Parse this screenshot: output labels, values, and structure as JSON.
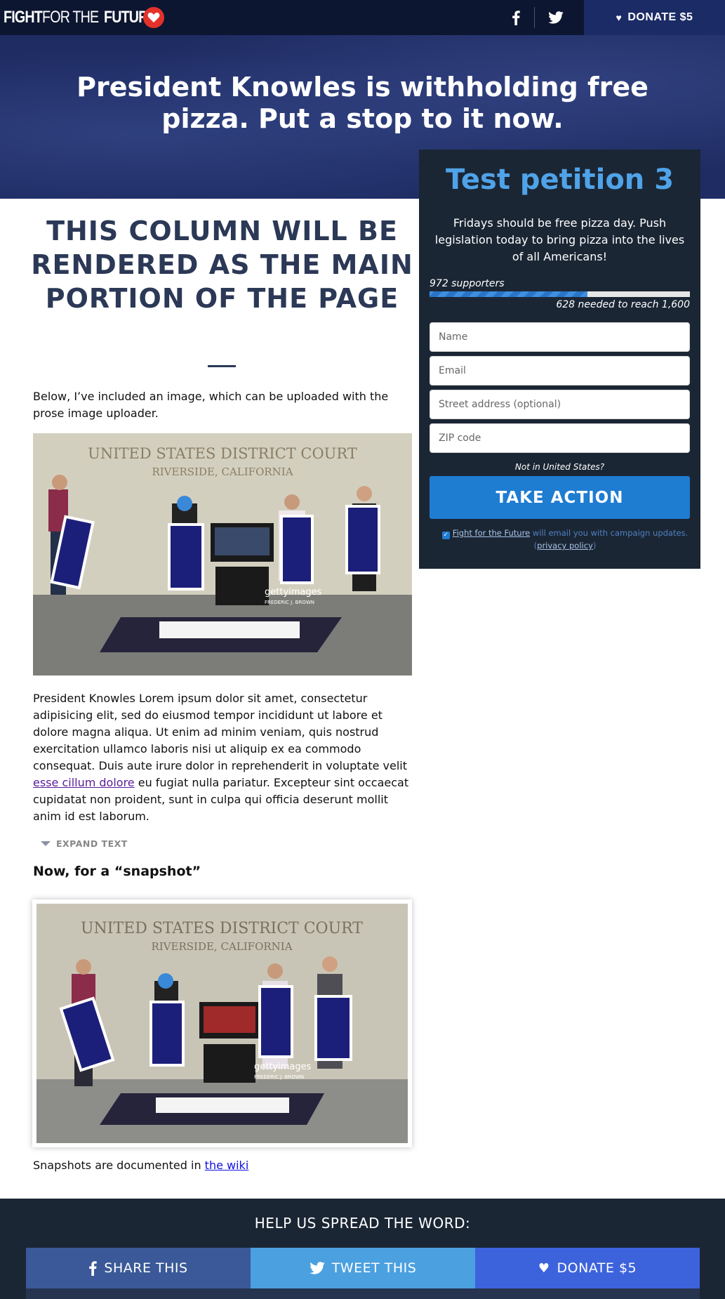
{
  "nav": {
    "logo_part1": "FIGHT",
    "logo_part2": "FOR THE",
    "logo_part3": "FUTURE",
    "donate_label": "DONATE $5"
  },
  "hero": {
    "title": "President Knowles is withholding free pizza. Put a stop to it now."
  },
  "petition": {
    "title": "Test petition 3",
    "description": "Fridays should be free pizza day. Push legislation today to bring pizza into the lives of all Americans!",
    "supporters": "972 supporters",
    "needed": "628 needed to reach 1,600",
    "progress_fraction": 0.6075,
    "fields": {
      "name_placeholder": "Name",
      "email_placeholder": "Email",
      "address_placeholder": "Street address (optional)",
      "zip_placeholder": "ZIP code"
    },
    "not_in_us": "Not in United States?",
    "submit_label": "TAKE ACTION",
    "optin_org": "Fight for the Future",
    "optin_text": " will email you with campaign updates.",
    "privacy_label": "privacy policy",
    "privacy_open": "(",
    "privacy_close": ")"
  },
  "main": {
    "heading": "THIS COLUMN WILL BE RENDERED AS THE MAIN PORTION OF THE PAGE",
    "intro": "Below, I’ve included an image, which can be uploaded with the prose image uploader.",
    "photo1": {
      "sign_line1": "UNITED STATES DISTRICT COURT",
      "sign_line2": "RIVERSIDE, CALIFORNIA",
      "watermark": "gettyimages",
      "credit": "FREDERIC J. BROWN"
    },
    "body_part1": "President Knowles Lorem ipsum dolor sit amet, consectetur adipisicing elit, sed do eiusmod tempor incididunt ut labore et dolore magna aliqua. Ut enim ad minim veniam, quis nostrud exercitation ullamco laboris nisi ut aliquip ex ea commodo consequat. Duis aute irure dolor in reprehenderit in voluptate velit ",
    "body_link": "esse cillum dolore",
    "body_part2": " eu fugiat nulla pariatur. Excepteur sint occaecat cupidatat non proident, sunt in culpa qui officia deserunt mollit anim id est laborum.",
    "expand_label": "EXPAND TEXT",
    "snapshot_heading": "Now, for a “snapshot”",
    "photo2": {
      "sign_line1": "UNITED STATES DISTRICT COURT",
      "sign_line2": "RIVERSIDE, CALIFORNIA",
      "watermark": "gettyimages",
      "credit": "FREDERIC J. BROWN"
    },
    "wiki_prefix": "Snapshots are documented in ",
    "wiki_link": "the wiki"
  },
  "footer": {
    "spread_label": "HELP US SPREAD THE WORD:",
    "share_label": "SHARE THIS",
    "tweet_label": "TWEET THIS",
    "donate_label": "DONATE $5"
  },
  "colors": {
    "nav_bg": "#0d1630",
    "hero_bg": "#1f2c63",
    "card_bg": "#1b2634",
    "accent_blue": "#1e7cd1",
    "title_blue": "#4fa3e8",
    "heading_navy": "#2b3856",
    "fb_blue": "#3b5998",
    "tw_blue": "#4ba0e0",
    "donate_blue": "#3d63dc",
    "brand_red": "#e4322b"
  },
  "icons": [
    "heart-icon",
    "facebook-icon",
    "twitter-icon",
    "checkbox-checked-icon",
    "caret-down-icon"
  ]
}
